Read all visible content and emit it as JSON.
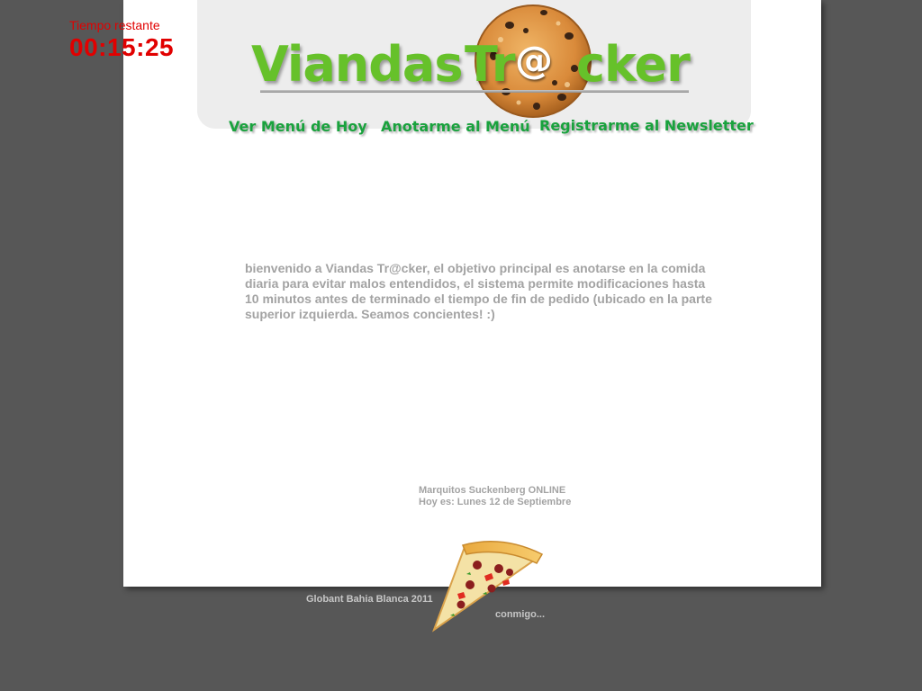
{
  "timer": {
    "label": "Tiempo restante",
    "value": "00:15:25",
    "color": "#e10000"
  },
  "header": {
    "logo_part1": "Viandas",
    "logo_part2": "Tr",
    "logo_at": "@",
    "logo_part3": "cker",
    "logo_color": "#66c12a"
  },
  "nav": {
    "items": [
      {
        "label": "Ver Menú de Hoy"
      },
      {
        "label": "Anotarme al Menú"
      },
      {
        "label": "Registrarme al Newsletter"
      }
    ],
    "color": "#19a23d"
  },
  "main": {
    "welcome_text": "bienvenido a Viandas Tr@cker, el objetivo principal es anotarse en la comida diaria para evitar malos entendidos, el sistema permite modificaciones hasta 10 minutos antes de terminado el tiempo de fin de pedido (ubicado en la parte superior izquierda. Seamos concientes! :)"
  },
  "status": {
    "user_online": "Marquitos Suckenberg ONLINE",
    "today": "Hoy es: Lunes 12 de Septiembre"
  },
  "footer": {
    "company": "Globant Bahia Blanca 2011",
    "link": "conmigo..."
  },
  "colors": {
    "background": "#575757",
    "page": "#ffffff",
    "header_panel": "#ededed",
    "text_gray": "#a3a3a3"
  }
}
